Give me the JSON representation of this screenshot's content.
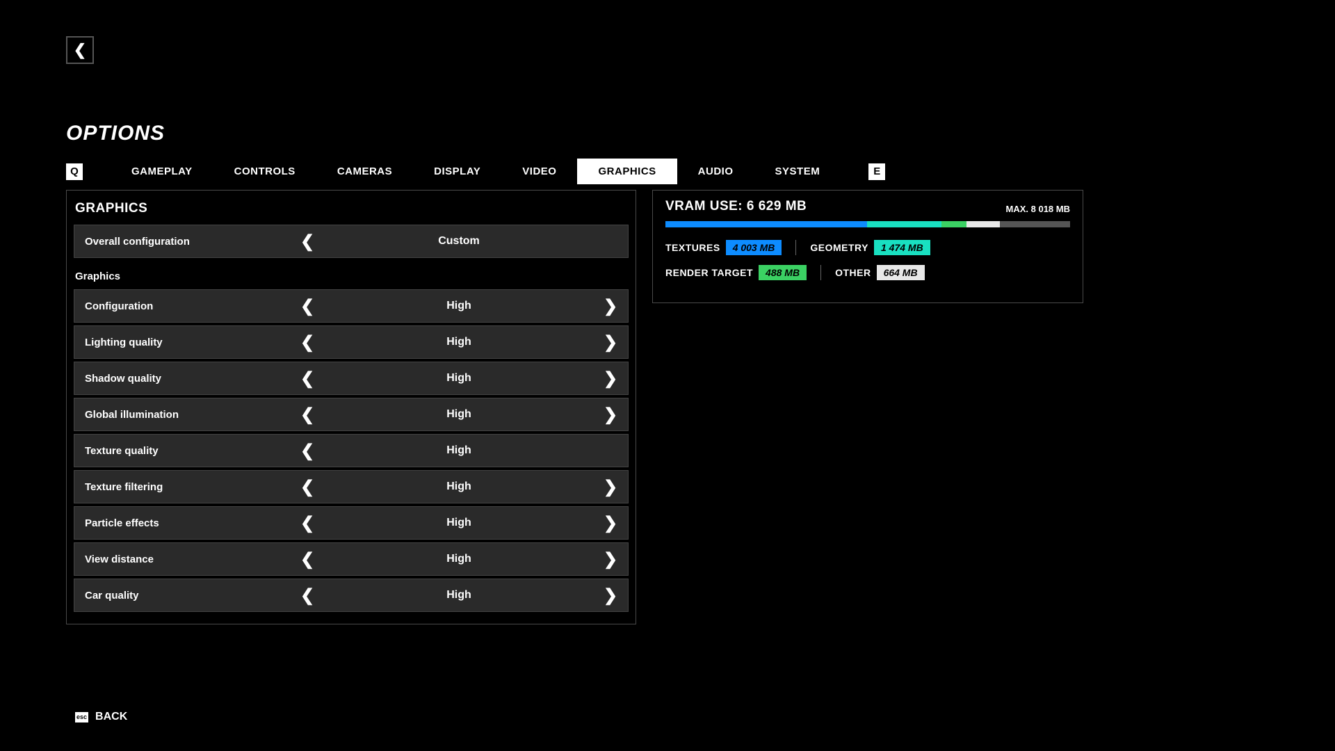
{
  "header": {
    "title": "OPTIONS",
    "prev_key": "Q",
    "next_key": "E"
  },
  "tabs": [
    "GAMEPLAY",
    "CONTROLS",
    "CAMERAS",
    "DISPLAY",
    "VIDEO",
    "GRAPHICS",
    "AUDIO",
    "SYSTEM"
  ],
  "active_tab": "GRAPHICS",
  "panel": {
    "title": "GRAPHICS",
    "overall": {
      "label": "Overall configuration",
      "value": "Custom",
      "left": true,
      "right": false
    },
    "subheader": "Graphics",
    "rows": [
      {
        "label": "Configuration",
        "value": "High",
        "left": true,
        "right": true
      },
      {
        "label": "Lighting quality",
        "value": "High",
        "left": true,
        "right": true
      },
      {
        "label": "Shadow quality",
        "value": "High",
        "left": true,
        "right": true
      },
      {
        "label": "Global illumination",
        "value": "High",
        "left": true,
        "right": true
      },
      {
        "label": "Texture quality",
        "value": "High",
        "left": true,
        "right": false
      },
      {
        "label": "Texture filtering",
        "value": "High",
        "left": true,
        "right": true
      },
      {
        "label": "Particle effects",
        "value": "High",
        "left": true,
        "right": true
      },
      {
        "label": "View distance",
        "value": "High",
        "left": true,
        "right": true
      },
      {
        "label": "Car quality",
        "value": "High",
        "left": true,
        "right": true
      }
    ]
  },
  "vram": {
    "title": "VRAM USE: 6 629 MB",
    "max": "MAX. 8 018 MB",
    "segments": [
      {
        "name": "TEXTURES",
        "value": "4 003 MB",
        "color": "#0d8cff",
        "pct": 49.9
      },
      {
        "name": "GEOMETRY",
        "value": "1 474 MB",
        "color": "#19e0c1",
        "pct": 18.4
      },
      {
        "name": "RENDER TARGET",
        "value": "488 MB",
        "color": "#3bd163",
        "pct": 6.1
      },
      {
        "name": "OTHER",
        "value": "664 MB",
        "color": "#e8e8e8",
        "pct": 8.3
      }
    ]
  },
  "footer": {
    "key": "esc",
    "label": "BACK"
  }
}
